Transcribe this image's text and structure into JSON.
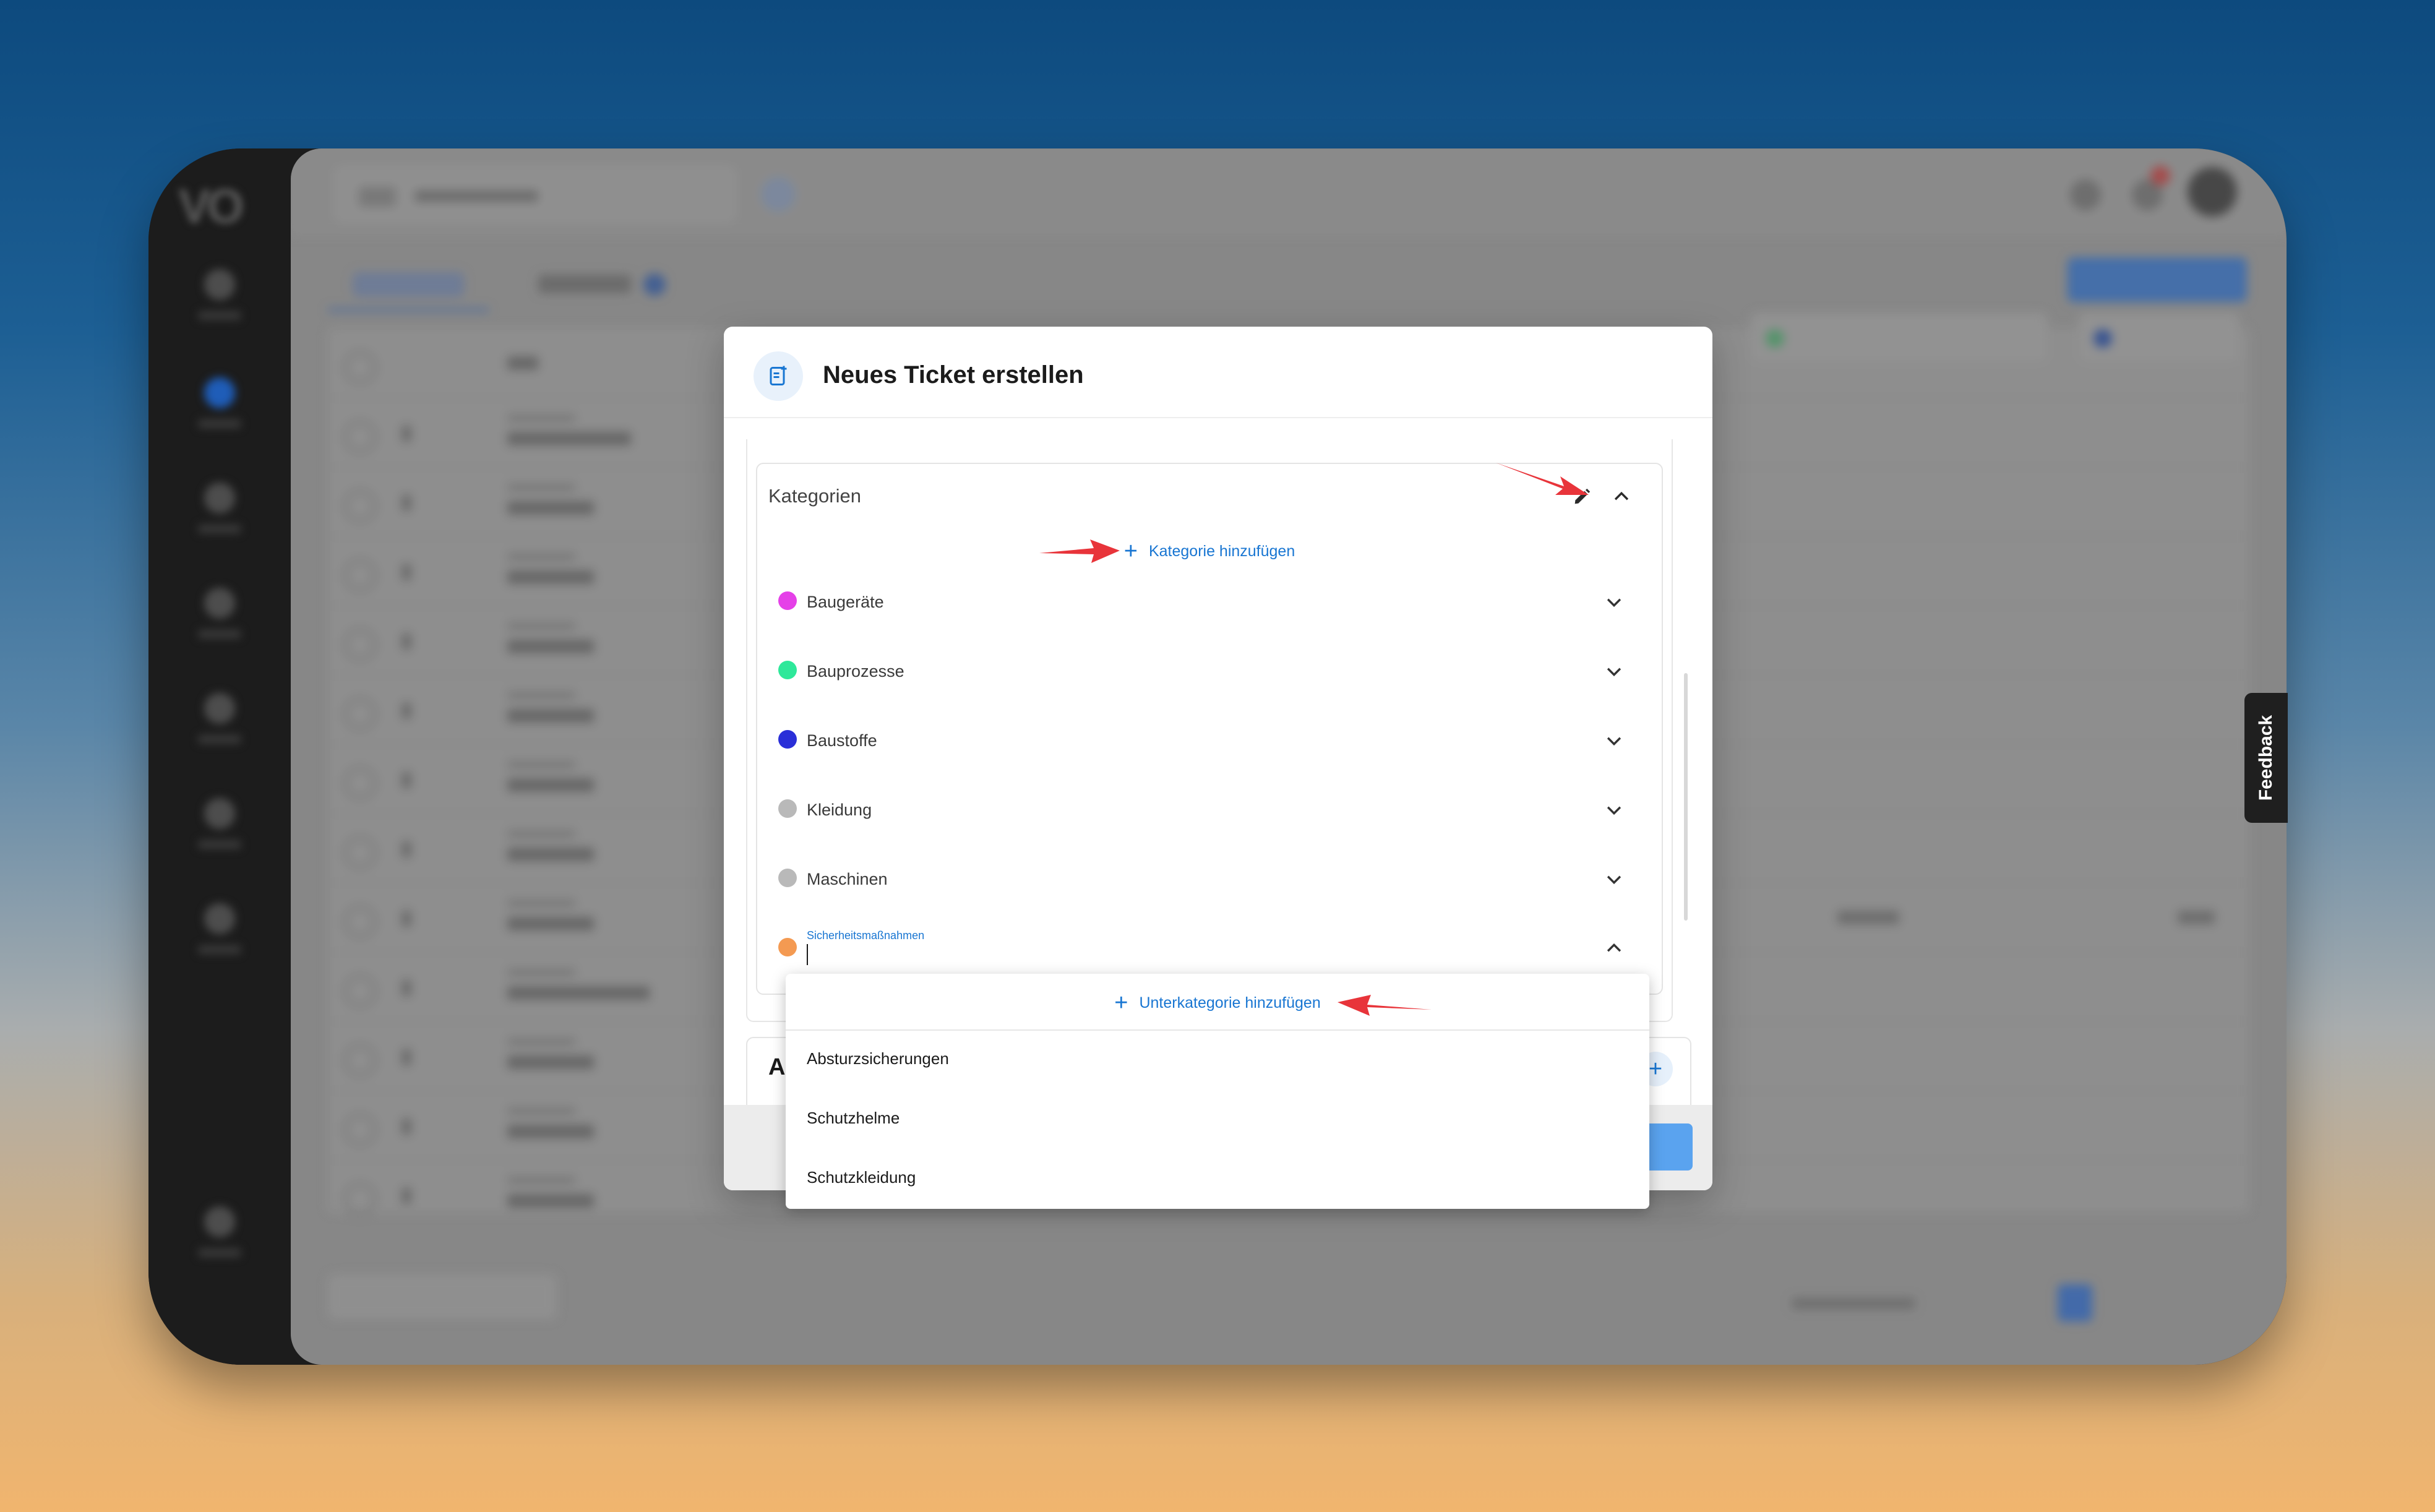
{
  "feedback_label": "Feedback",
  "modal": {
    "title": "Neues Ticket erstellen",
    "partial_section_label": "An"
  },
  "categories": {
    "title": "Kategorien",
    "add_label": "Kategorie hinzufügen",
    "items": [
      {
        "label": "Baugeräte",
        "color": "#e540e8"
      },
      {
        "label": "Bauprozesse",
        "color": "#2ee89a"
      },
      {
        "label": "Baustoffe",
        "color": "#2a2fd8"
      },
      {
        "label": "Kleidung",
        "color": "#b9b9b9"
      },
      {
        "label": "Maschinen",
        "color": "#b9b9b9"
      },
      {
        "label": "Sicherheitsmaßnahmen",
        "color": "#f49a52",
        "expanded": true
      }
    ]
  },
  "subcategories": {
    "add_label": "Unterkategorie hinzufügen",
    "items": [
      "Absturzsicherungen",
      "Schutzhelme",
      "Schutzkleidung"
    ]
  },
  "colors": {
    "accent": "#1976d2",
    "annotation_arrow": "#e8343a"
  }
}
